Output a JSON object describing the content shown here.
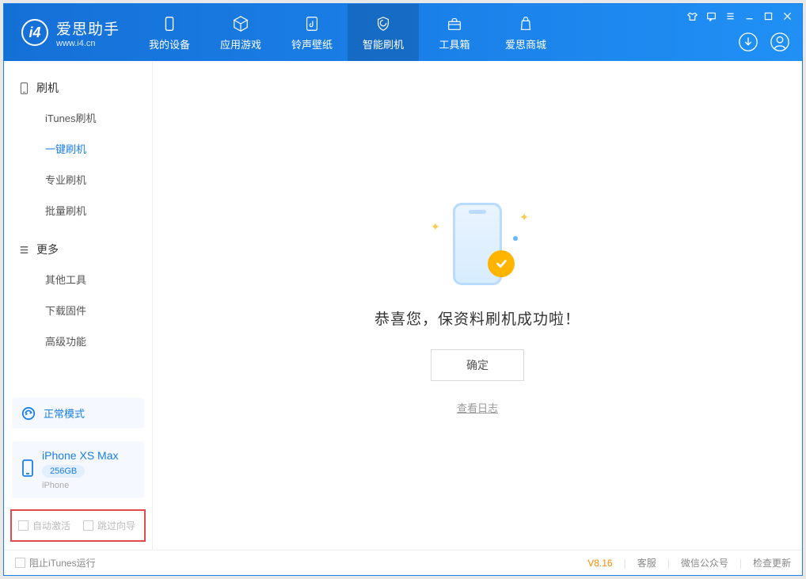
{
  "brand": {
    "name": "爱思助手",
    "site": "www.i4.cn"
  },
  "nav": {
    "items": [
      {
        "label": "我的设备",
        "icon": "device"
      },
      {
        "label": "应用游戏",
        "icon": "cube"
      },
      {
        "label": "铃声壁纸",
        "icon": "music"
      },
      {
        "label": "智能刷机",
        "icon": "shield",
        "active": true
      },
      {
        "label": "工具箱",
        "icon": "toolbox"
      },
      {
        "label": "爱思商城",
        "icon": "store"
      }
    ]
  },
  "sidebar": {
    "group1": {
      "title": "刷机",
      "items": [
        {
          "label": "iTunes刷机"
        },
        {
          "label": "一键刷机",
          "active": true
        },
        {
          "label": "专业刷机"
        },
        {
          "label": "批量刷机"
        }
      ]
    },
    "group2": {
      "title": "更多",
      "items": [
        {
          "label": "其他工具"
        },
        {
          "label": "下载固件"
        },
        {
          "label": "高级功能"
        }
      ]
    },
    "mode": "正常模式",
    "device": {
      "name": "iPhone XS Max",
      "capacity": "256GB",
      "type": "iPhone"
    },
    "checks": {
      "auto_activate": "自动激活",
      "skip_guide": "跳过向导"
    }
  },
  "main": {
    "success_text": "恭喜您，保资料刷机成功啦！",
    "ok_label": "确定",
    "log_link": "查看日志"
  },
  "footer": {
    "block_itunes": "阻止iTunes运行",
    "version": "V8.16",
    "links": {
      "support": "客服",
      "wechat": "微信公众号",
      "update": "检查更新"
    }
  }
}
